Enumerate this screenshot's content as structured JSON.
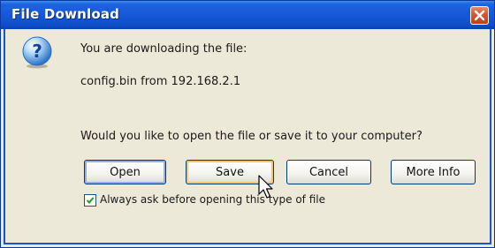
{
  "window": {
    "title": "File Download"
  },
  "message": {
    "line1": "You are downloading the file:",
    "file": "config.bin from 192.168.2.1",
    "question": "Would you like to open the file or save it to your computer?"
  },
  "buttons": {
    "open": "Open",
    "save": "Save",
    "cancel": "Cancel",
    "more_info": "More Info"
  },
  "checkbox": {
    "label": "Always ask before opening this type of file",
    "checked": true
  },
  "icons": {
    "question": "question-icon",
    "close": "close-icon",
    "cursor": "mouse-pointer-icon",
    "check": "checkmark-icon"
  },
  "colors": {
    "titlebar": "#1658d8",
    "close_button": "#d9542e",
    "dialog_bg": "#ece9d8"
  }
}
